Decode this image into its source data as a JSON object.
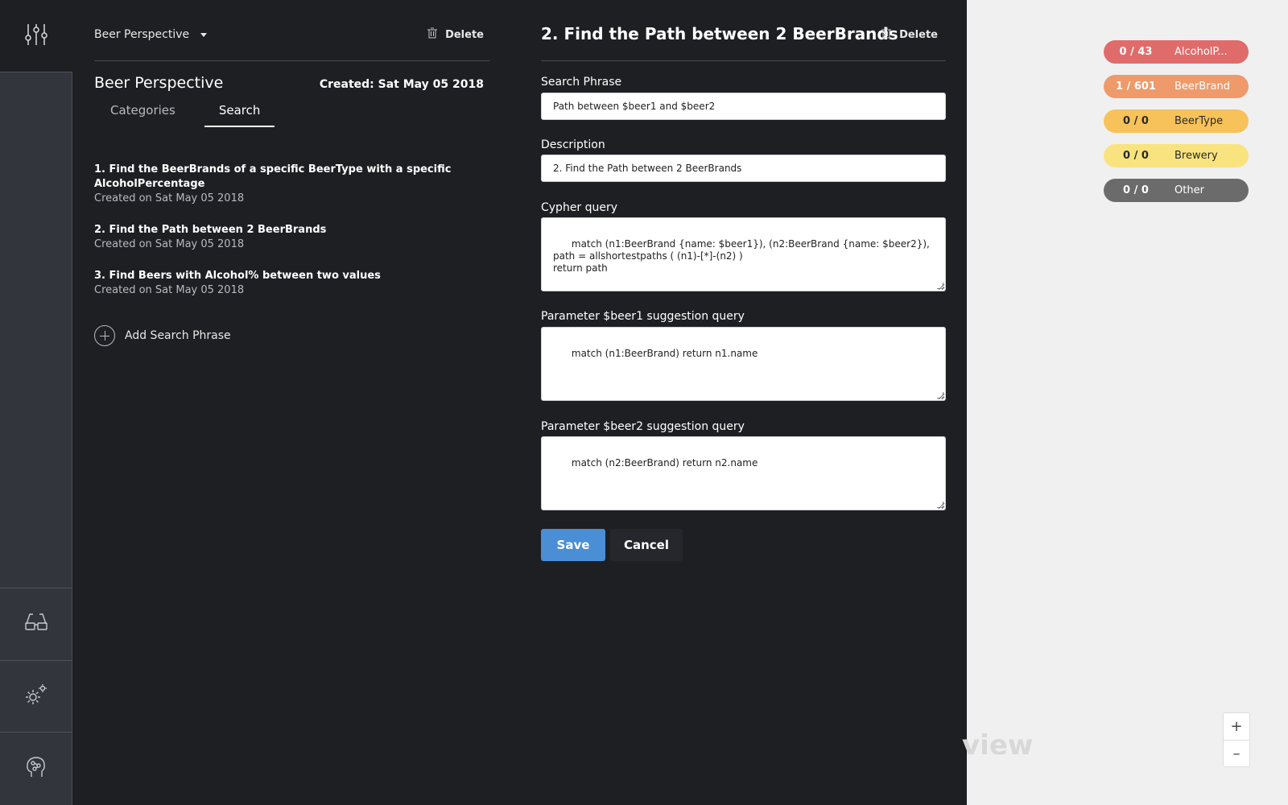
{
  "nav": {
    "top_icon": "sliders-icon",
    "buttons": [
      "glasses-icon",
      "settings-gear-icon",
      "brain-icon"
    ]
  },
  "perspective": {
    "selected": "Beer Perspective",
    "delete_label": "Delete",
    "title": "Beer Perspective",
    "created": "Created: Sat May 05 2018",
    "tabs": [
      {
        "label": "Categories",
        "active": false
      },
      {
        "label": "Search",
        "active": true
      }
    ],
    "phrases": [
      {
        "title": "1. Find the BeerBrands of a specific BeerType with a specific AlcoholPercentage",
        "date": "Created on Sat May 05 2018"
      },
      {
        "title": "2. Find the Path between 2 BeerBrands",
        "date": "Created on Sat May 05 2018"
      },
      {
        "title": "3. Find Beers with Alcohol% between two values",
        "date": "Created on Sat May 05 2018"
      }
    ],
    "add_label": "Add Search Phrase"
  },
  "form": {
    "title": "2. Find the Path between 2 BeerBrands",
    "delete_label": "Delete",
    "search_phrase_label": "Search Phrase",
    "search_phrase_value": "Path between $beer1 and $beer2",
    "description_label": "Description",
    "description_value": "2. Find the Path between 2 BeerBrands",
    "cypher_label": "Cypher query",
    "cypher_value": "match (n1:BeerBrand {name: $beer1}), (n2:BeerBrand {name: $beer2}),\npath = allshortestpaths ( (n1)-[*]-(n2) )\nreturn path",
    "param1_label": "Parameter $beer1 suggestion query",
    "param1_value": "match (n1:BeerBrand) return n1.name",
    "param2_label": "Parameter $beer2 suggestion query",
    "param2_value": "match (n2:BeerBrand) return n2.name",
    "save_label": "Save",
    "cancel_label": "Cancel"
  },
  "legend": [
    {
      "count": "0 / 43",
      "label": "AlcoholP...",
      "color": "#e06b6b",
      "text": "#ffffff"
    },
    {
      "count": "1 / 601",
      "label": "BeerBrand",
      "color": "#ee9a6a",
      "text": "#ffffff"
    },
    {
      "count": "0 / 0",
      "label": "BeerType",
      "color": "#f7c25a",
      "text": "#2a2a2a"
    },
    {
      "count": "0 / 0",
      "label": "Brewery",
      "color": "#f9e37f",
      "text": "#2a2a2a"
    },
    {
      "count": "0 / 0",
      "label": "Other",
      "color": "#6b6b6b",
      "text": "#ffffff"
    }
  ],
  "watermark": "view",
  "zoom": {
    "in": "+",
    "out": "–"
  }
}
